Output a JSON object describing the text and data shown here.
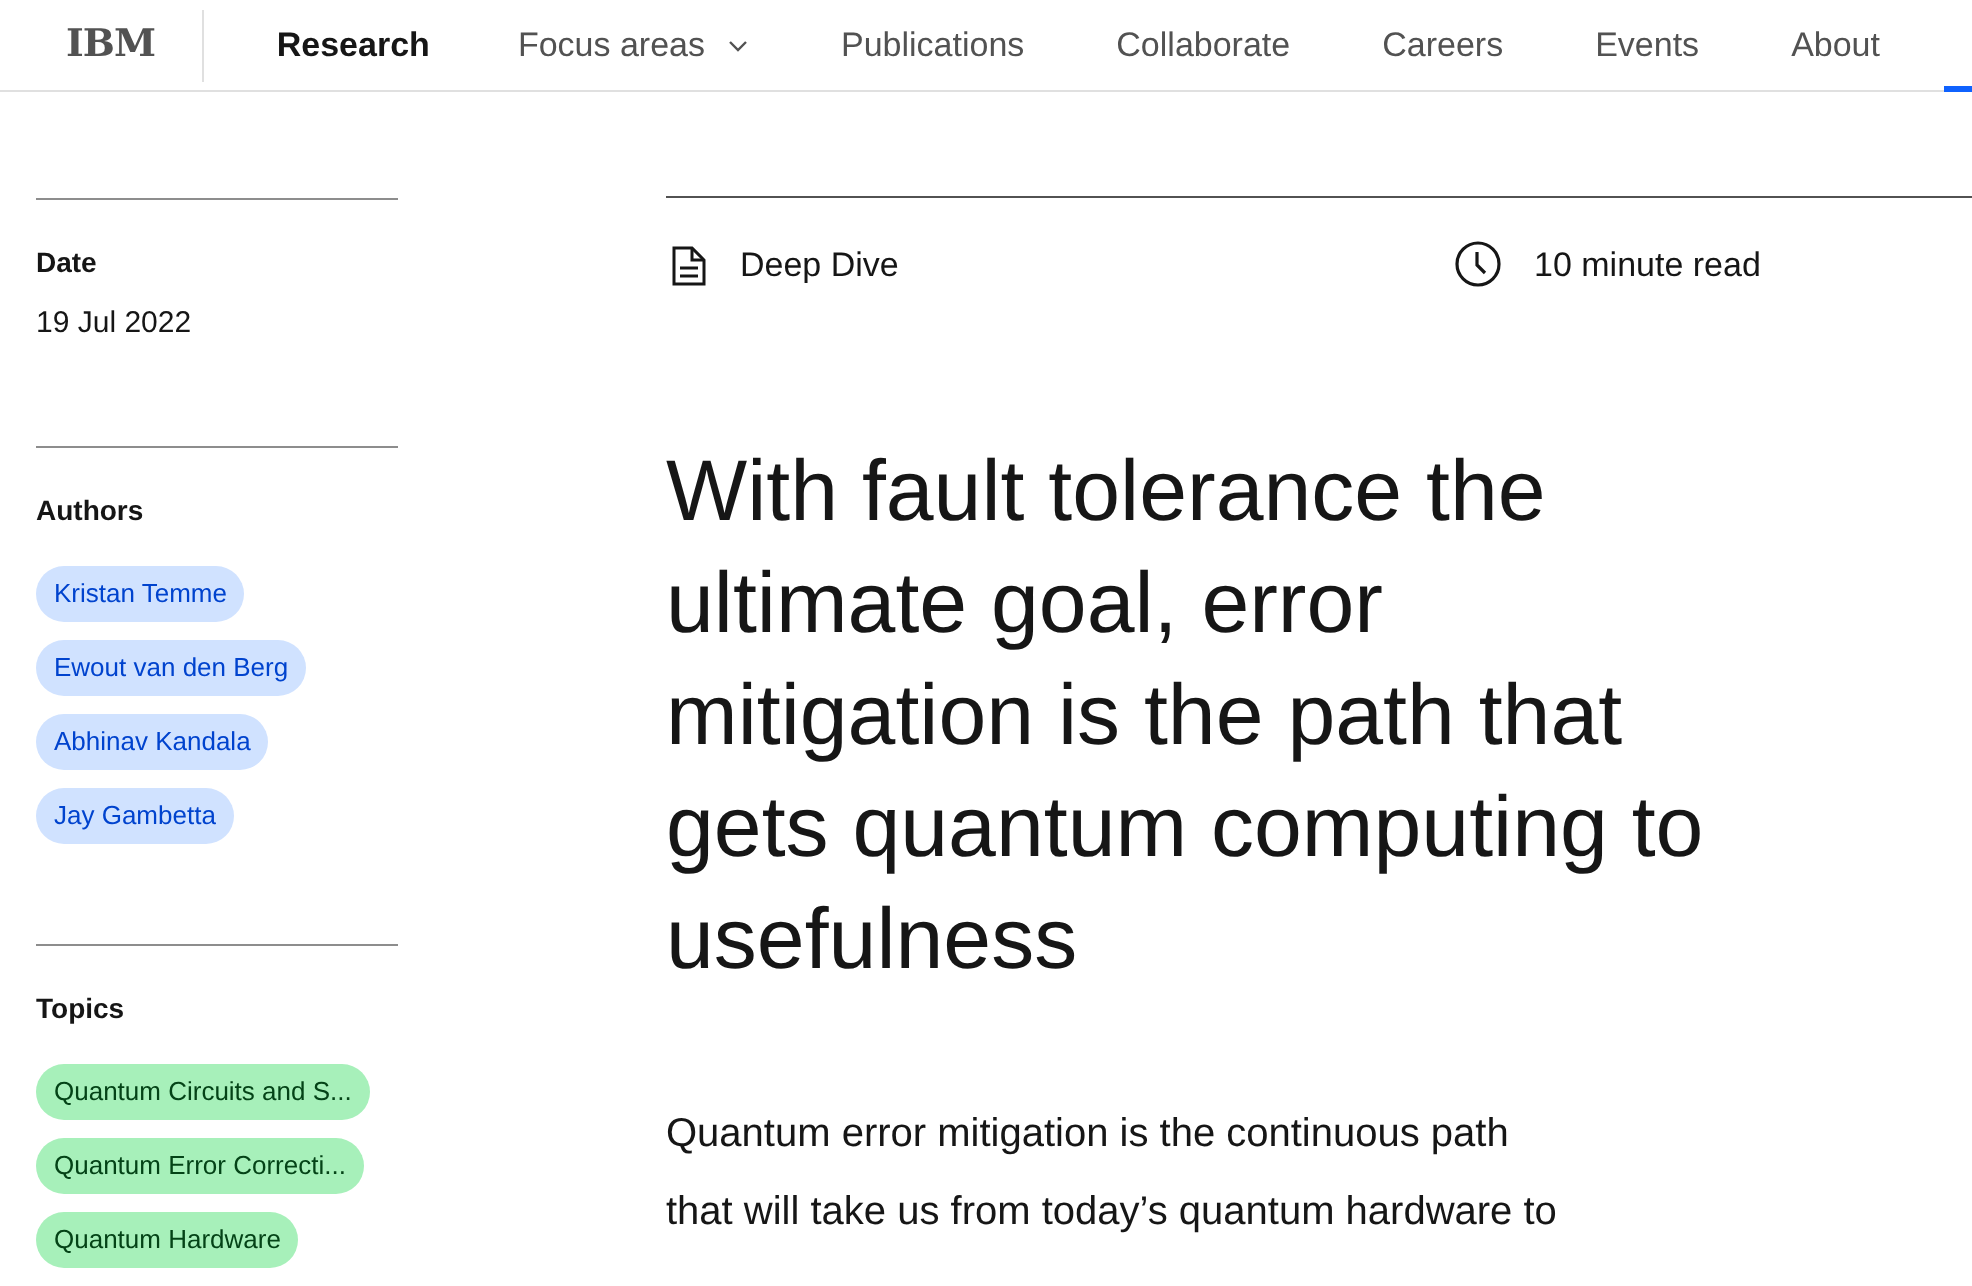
{
  "nav": {
    "logo": "IBM",
    "items": [
      {
        "label": "Research",
        "selected": true,
        "dropdown": false
      },
      {
        "label": "Focus areas",
        "selected": false,
        "dropdown": true
      },
      {
        "label": "Publications",
        "selected": false,
        "dropdown": false
      },
      {
        "label": "Collaborate",
        "selected": false,
        "dropdown": false
      },
      {
        "label": "Careers",
        "selected": false,
        "dropdown": false
      },
      {
        "label": "Events",
        "selected": false,
        "dropdown": false
      },
      {
        "label": "About",
        "selected": false,
        "dropdown": false
      }
    ]
  },
  "sidebar": {
    "date": {
      "label": "Date",
      "value": "19 Jul 2022"
    },
    "authors": {
      "label": "Authors",
      "items": [
        "Kristan Temme",
        "Ewout van den Berg",
        "Abhinav Kandala",
        "Jay Gambetta"
      ]
    },
    "topics": {
      "label": "Topics",
      "items": [
        "Quantum Circuits and S...",
        "Quantum Error Correcti...",
        "Quantum Hardware"
      ]
    }
  },
  "article": {
    "type": "Deep Dive",
    "read_time": "10 minute read",
    "title": "With fault tolerance the ultimate goal, error mitigation is the path that gets quantum computing to usefulness",
    "lead": "Quantum error mitigation is the continuous path that will take us from today’s quantum hardware to"
  }
}
